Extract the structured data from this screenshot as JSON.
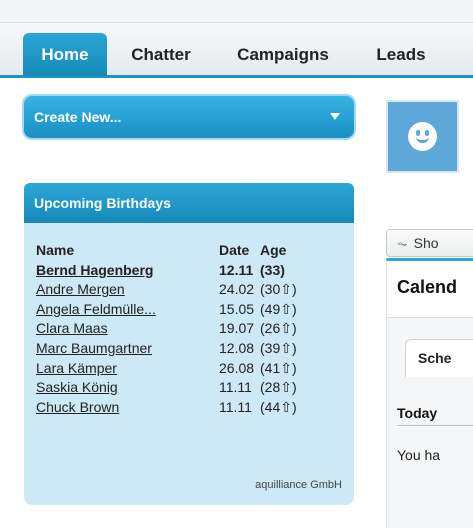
{
  "tabs": [
    {
      "label": "Home"
    },
    {
      "label": "Chatter"
    },
    {
      "label": "Campaigns"
    },
    {
      "label": "Leads"
    }
  ],
  "create_new": {
    "label": "Create New..."
  },
  "birthdays": {
    "header": "Upcoming Birthdays",
    "columns": [
      "Name",
      "Date",
      "Age"
    ],
    "rows": [
      {
        "name": "Bernd Hagenberg",
        "date": "12.11",
        "age": "(33)"
      },
      {
        "name": "Andre Mergen",
        "date": "24.02",
        "age": "(30⇧)"
      },
      {
        "name": "Angela Feldmülle...",
        "date": "15.05",
        "age": "(49⇧)"
      },
      {
        "name": "Clara Maas",
        "date": "19.07",
        "age": "(26⇧)"
      },
      {
        "name": "Marc Baumgartner",
        "date": "12.08",
        "age": "(39⇧)"
      },
      {
        "name": "Lara Kämper",
        "date": "26.08",
        "age": "(41⇧)"
      },
      {
        "name": "Saskia König",
        "date": "11.11",
        "age": "(28⇧)"
      },
      {
        "name": "Chuck Brown",
        "date": "11.11",
        "age": "(44⇧)"
      }
    ],
    "footer": "aquilliance GmbH"
  },
  "right": {
    "show_button": "Sho",
    "calendar_title": "Calend",
    "schedule_tab": "Sche",
    "today_label": "Today",
    "no_events_text": "You ha"
  },
  "colors": {
    "accent": "#1a96c6",
    "panel_bg": "#cde9f5",
    "avatar_bg": "#5da7d9"
  }
}
